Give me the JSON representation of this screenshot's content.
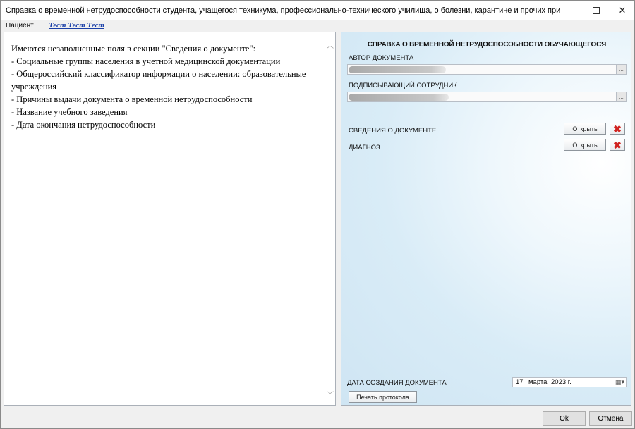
{
  "window": {
    "title": "Справка о временной нетрудоспособности студента, учащегося техникума, профессионально-технического училища, о болезни, карантине и прочих причинах отсутствия ...",
    "minimize_icon": "minimize-icon",
    "maximize_icon": "maximize-icon",
    "close_icon": "close-icon"
  },
  "patient": {
    "label": "Пациент",
    "name": "Тест Тест Тест"
  },
  "warnings": {
    "heading": "Имеются незаполненные поля в секции \"Сведения о документе\":",
    "items": [
      "- Социальные группы населения в учетной медицинской документации",
      "- Общероссийский классификатор информации о населении: образовательные учреждения",
      "- Причины выдачи документа о временной нетрудоспособности",
      "- Название учебного заведения",
      "- Дата окончания нетрудоспособности"
    ]
  },
  "document": {
    "title": "СПРАВКА О ВРЕМЕННОЙ НЕТРУДОСПОСОБНОСТИ ОБУЧАЮЩЕГОСЯ",
    "author_label": "АВТОР ДОКУМЕНТА",
    "signer_label": "ПОДПИСЫВАЮЩИЙ СОТРУДНИК",
    "ellipsis": "...",
    "sections": [
      {
        "label": "СВЕДЕНИЯ О ДОКУМЕНТЕ",
        "open_label": "Открыть"
      },
      {
        "label": "ДИАГНОЗ",
        "open_label": "Открыть"
      }
    ],
    "creation_date_label": "ДАТА СОЗДАНИЯ ДОКУМЕНТА",
    "date": {
      "day": "17",
      "month": "марта",
      "year": "2023 г."
    },
    "print_button": "Печать протокола"
  },
  "footer": {
    "ok": "Ok",
    "cancel": "Отмена"
  }
}
